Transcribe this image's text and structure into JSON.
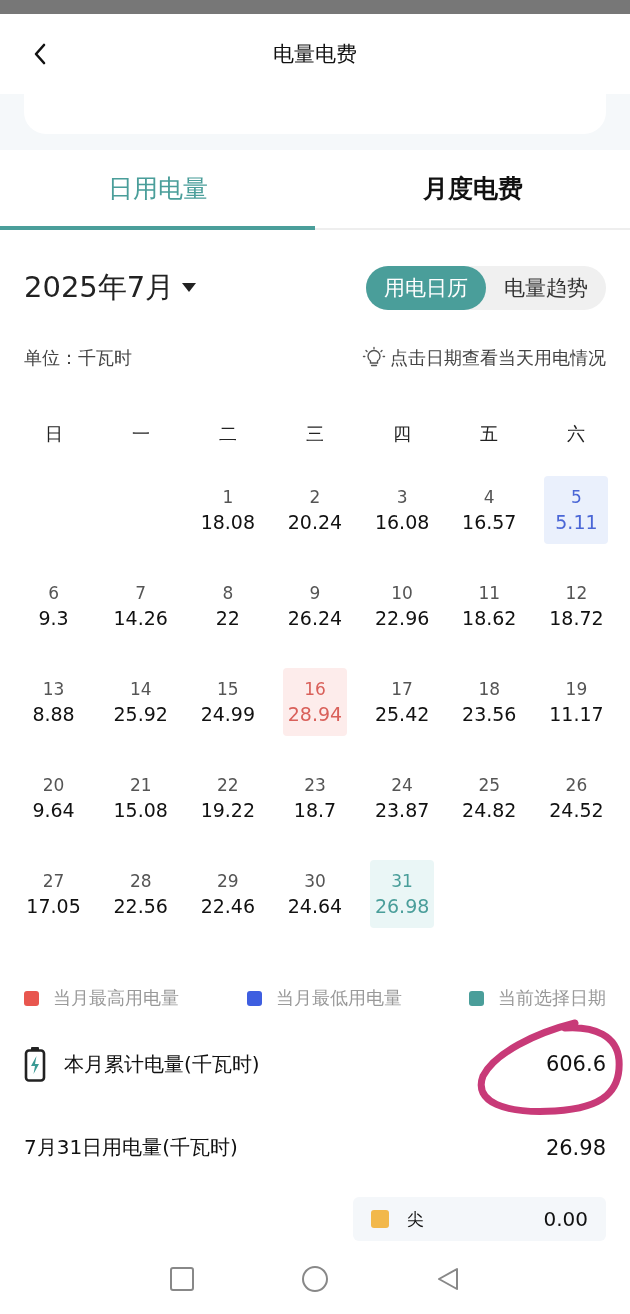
{
  "header": {
    "title": "电量电费"
  },
  "tabs": [
    {
      "label": "日用电量",
      "selected": true
    },
    {
      "label": "月度电费",
      "selected": false
    }
  ],
  "month_picker": {
    "label": "2025年7月"
  },
  "view_toggle": [
    {
      "label": "用电日历",
      "selected": true
    },
    {
      "label": "电量趋势",
      "selected": false
    }
  ],
  "unit": "单位：千瓦时",
  "hint": "点击日期查看当天用电情况",
  "weekdays": [
    "日",
    "一",
    "二",
    "三",
    "四",
    "五",
    "六"
  ],
  "weeks": [
    [
      {
        "day": "1",
        "usage": "18.08",
        "kind": "normal"
      },
      {
        "day": "2",
        "usage": "20.24",
        "kind": "normal"
      },
      {
        "day": "3",
        "usage": "16.08",
        "kind": "normal"
      },
      {
        "day": "4",
        "usage": "16.57",
        "kind": "normal"
      },
      {
        "day": "5",
        "usage": "5.11",
        "kind": "min"
      }
    ],
    [
      {
        "day": "6",
        "usage": "9.3",
        "kind": "normal"
      },
      {
        "day": "7",
        "usage": "14.26",
        "kind": "normal"
      },
      {
        "day": "8",
        "usage": "22",
        "kind": "normal"
      },
      {
        "day": "9",
        "usage": "26.24",
        "kind": "normal"
      },
      {
        "day": "10",
        "usage": "22.96",
        "kind": "normal"
      },
      {
        "day": "11",
        "usage": "18.62",
        "kind": "normal"
      },
      {
        "day": "12",
        "usage": "18.72",
        "kind": "normal"
      }
    ],
    [
      {
        "day": "13",
        "usage": "8.88",
        "kind": "normal"
      },
      {
        "day": "14",
        "usage": "25.92",
        "kind": "normal"
      },
      {
        "day": "15",
        "usage": "24.99",
        "kind": "normal"
      },
      {
        "day": "16",
        "usage": "28.94",
        "kind": "max"
      },
      {
        "day": "17",
        "usage": "25.42",
        "kind": "normal"
      },
      {
        "day": "18",
        "usage": "23.56",
        "kind": "normal"
      },
      {
        "day": "19",
        "usage": "11.17",
        "kind": "normal"
      }
    ],
    [
      {
        "day": "20",
        "usage": "9.64",
        "kind": "normal"
      },
      {
        "day": "21",
        "usage": "15.08",
        "kind": "normal"
      },
      {
        "day": "22",
        "usage": "19.22",
        "kind": "normal"
      },
      {
        "day": "23",
        "usage": "18.7",
        "kind": "normal"
      },
      {
        "day": "24",
        "usage": "23.87",
        "kind": "normal"
      },
      {
        "day": "25",
        "usage": "24.82",
        "kind": "normal"
      },
      {
        "day": "26",
        "usage": "24.52",
        "kind": "normal"
      }
    ],
    [
      {
        "day": "27",
        "usage": "17.05",
        "kind": "normal"
      },
      {
        "day": "28",
        "usage": "22.56",
        "kind": "normal"
      },
      {
        "day": "29",
        "usage": "22.46",
        "kind": "normal"
      },
      {
        "day": "30",
        "usage": "24.64",
        "kind": "normal"
      },
      {
        "day": "31",
        "usage": "26.98",
        "kind": "selected"
      }
    ]
  ],
  "legend": [
    {
      "label": "当月最高用电量",
      "color": "#e8564f"
    },
    {
      "label": "当月最低用电量",
      "color": "#3e5ee0"
    },
    {
      "label": "当前选择日期",
      "color": "#4a9e9a"
    }
  ],
  "total": {
    "label": "本月累计电量(千瓦时)",
    "value": "606.6"
  },
  "day_total": {
    "label": "7月31日用电量(千瓦时)",
    "value": "26.98"
  },
  "breakdown": [
    {
      "label": "尖",
      "value": "0.00",
      "color": "#f2b84b"
    }
  ],
  "annotation": {
    "kind": "hand-drawn-circle"
  }
}
